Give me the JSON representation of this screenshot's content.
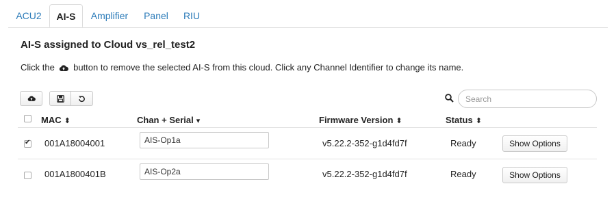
{
  "tabs": [
    {
      "label": "ACU2",
      "active": false
    },
    {
      "label": "AI-S",
      "active": true
    },
    {
      "label": "Amplifier",
      "active": false
    },
    {
      "label": "Panel",
      "active": false
    },
    {
      "label": "RIU",
      "active": false
    }
  ],
  "section": {
    "title": "AI-S assigned to Cloud vs_rel_test2",
    "desc_before": "Click the",
    "desc_after": "button to remove the selected AI-S from this cloud. Click any Channel Identifier to change its name."
  },
  "toolbar": {
    "remove_icon": "cloud-icon",
    "save_icon": "save-icon",
    "refresh_icon": "refresh-icon"
  },
  "search": {
    "placeholder": "Search",
    "value": ""
  },
  "table": {
    "headers": {
      "mac": "MAC",
      "mac_sort": "⬍",
      "chan": "Chan + Serial",
      "chan_sort": "▾",
      "firmware": "Firmware Version",
      "firmware_sort": "⬍",
      "status": "Status",
      "status_sort": "⬍"
    },
    "select_all_checked": false,
    "rows": [
      {
        "checked": true,
        "mac": "001A18004001",
        "chan": "AIS-Op1a",
        "firmware": "v5.22.2-352-g1d4fd7f",
        "status": "Ready",
        "action": "Show Options"
      },
      {
        "checked": false,
        "mac": "001A1800401B",
        "chan": "AIS-Op2a",
        "firmware": "v5.22.2-352-g1d4fd7f",
        "status": "Ready",
        "action": "Show Options"
      }
    ]
  },
  "colors": {
    "link": "#2a7ab8",
    "text": "#222222",
    "border": "#dcdcdc"
  }
}
